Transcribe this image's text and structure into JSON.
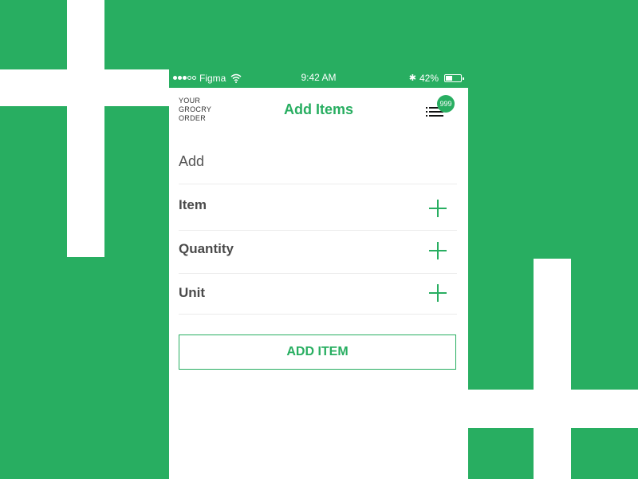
{
  "colors": {
    "accent": "#28ae61",
    "background": "#28ae61",
    "text_dark": "#4a4a4a"
  },
  "status_bar": {
    "signal_filled": 3,
    "signal_total": 5,
    "carrier": "Figma",
    "wifi_icon": "wifi-icon",
    "time": "9:42 AM",
    "bluetooth_icon": "bluetooth-icon",
    "battery_percent_label": "42%",
    "battery_level": 0.42
  },
  "header": {
    "brand_lines": [
      "YOUR",
      "GROCRY",
      "ORDER"
    ],
    "title": "Add Items",
    "menu_icon": "list-menu-icon",
    "badge_count": "999"
  },
  "form": {
    "section_label": "Add",
    "rows": [
      {
        "label": "Item",
        "action_icon": "plus-icon"
      },
      {
        "label": "Quantity",
        "action_icon": "plus-icon"
      },
      {
        "label": "Unit",
        "action_icon": "plus-icon"
      }
    ],
    "submit_label": "ADD ITEM"
  }
}
